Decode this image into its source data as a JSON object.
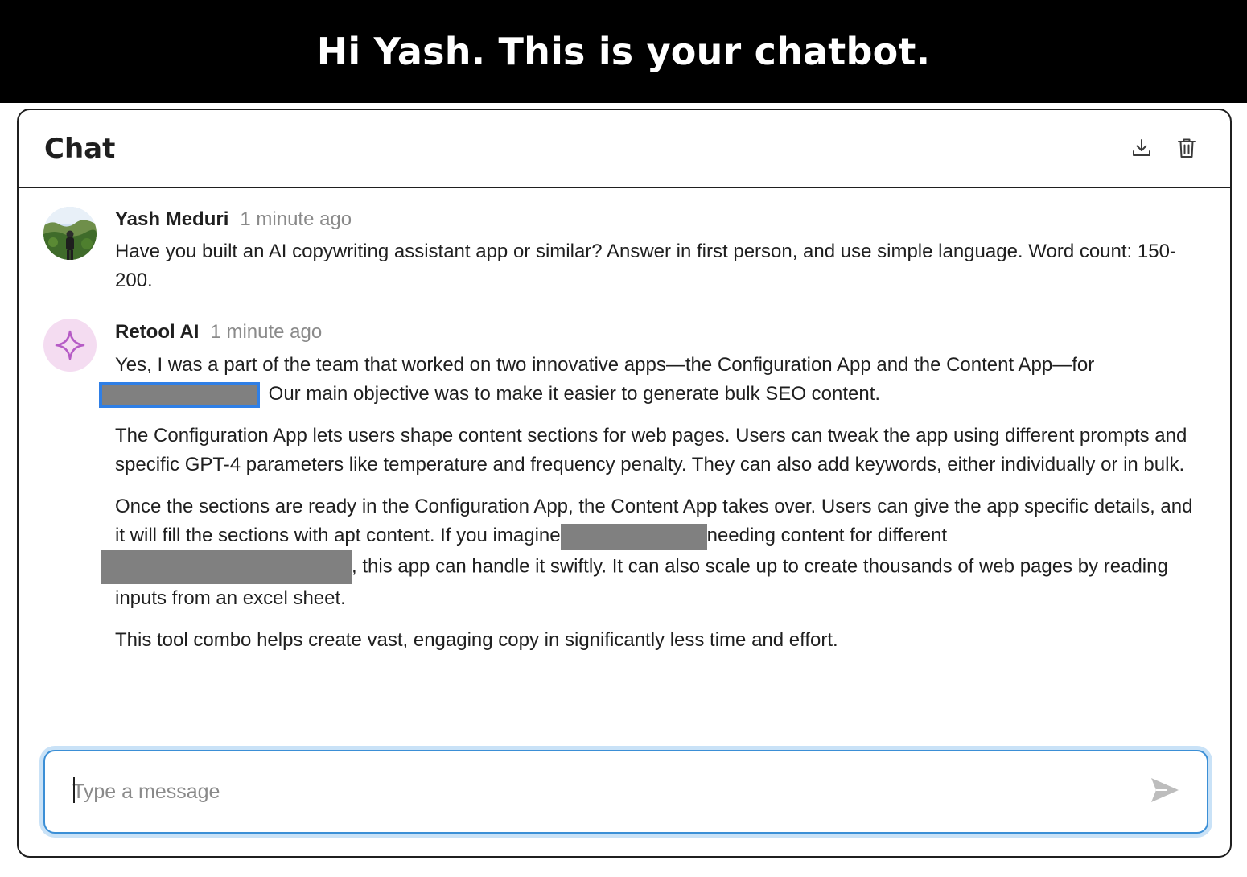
{
  "banner": {
    "title": "Hi Yash. This is your chatbot."
  },
  "chat": {
    "title": "Chat",
    "actions": {
      "download_icon": "download-icon",
      "delete_icon": "trash-icon"
    }
  },
  "messages": [
    {
      "author": "Yash Meduri",
      "time": "1 minute ago",
      "text": "Have you built an AI copywriting assistant app or similar? Answer in first person, and use simple language. Word count: 150-200."
    },
    {
      "author": "Retool AI",
      "time": "1 minute ago",
      "p1_before": "Yes, I was a part of the team that worked on two innovative apps—the Configuration App and the Content App—for",
      "p1_after": " Our main objective was to make it easier to generate bulk SEO content.",
      "p2": "The Configuration App lets users shape content sections for web pages. Users can tweak the app using different prompts and specific GPT-4 parameters like temperature and frequency penalty. They can also add keywords, either individually or in bulk.",
      "p3_a": "Once the sections are ready in the Configuration App, the Content App takes over. Users can give the app specific details, and it will fill the sections with apt content. If you imagine",
      "p3_b": "needing content for different",
      "p3_c": ", this app can handle it swiftly. It can also scale up to create thousands of web pages by reading inputs from an excel sheet.",
      "p4": "This tool combo helps create vast, engaging copy in significantly less time and effort."
    }
  ],
  "composer": {
    "placeholder": "Type a message",
    "value": ""
  },
  "colors": {
    "accent": "#3b8fd6",
    "ai_avatar_bg": "#f4dcf1",
    "ai_star": "#b65bc6",
    "redaction": "#808080"
  }
}
